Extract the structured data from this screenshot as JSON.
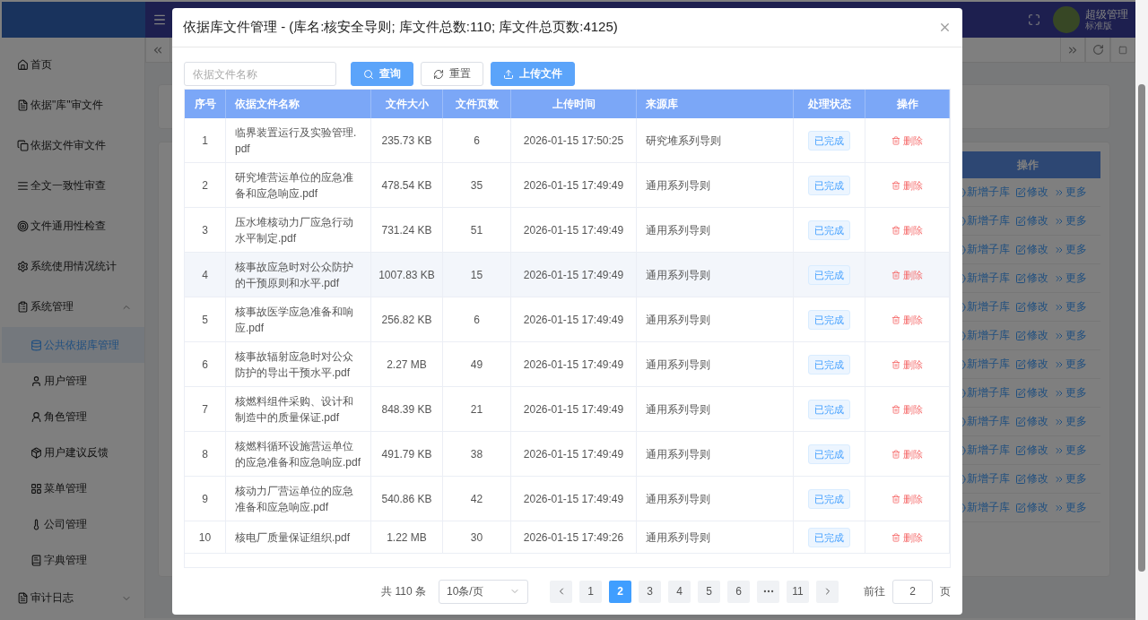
{
  "header": {
    "user_name": "超级管理",
    "edition": "标准版"
  },
  "sidebar": {
    "items": [
      {
        "label": "首页",
        "selected": false
      },
      {
        "label": "依据\"库\"审文件",
        "selected": false
      },
      {
        "label": "依据文件审文件",
        "selected": false
      },
      {
        "label": "全文一致性审查",
        "selected": false
      },
      {
        "label": "文件通用性检查",
        "selected": false
      },
      {
        "label": "系统使用情况统计",
        "selected": false
      },
      {
        "label": "系统管理",
        "selected": false,
        "expanded": true,
        "children": [
          {
            "label": "公共依据库管理",
            "selected": true
          },
          {
            "label": "用户管理",
            "selected": false
          },
          {
            "label": "角色管理",
            "selected": false
          },
          {
            "label": "用户建议反馈",
            "selected": false
          },
          {
            "label": "菜单管理",
            "selected": false
          },
          {
            "label": "公司管理",
            "selected": false
          },
          {
            "label": "字典管理",
            "selected": false
          }
        ]
      },
      {
        "label": "审计日志",
        "selected": false,
        "expanded": false
      }
    ]
  },
  "background_table": {
    "column_header": "操作",
    "rows": [
      {
        "actions": [
          "新增子库",
          "修改",
          "更多"
        ]
      },
      {
        "actions": [
          "新增子库",
          "修改",
          "更多"
        ]
      },
      {
        "actions": [
          "新增子库",
          "修改",
          "更多"
        ]
      },
      {
        "actions": [
          "新增子库",
          "修改",
          "更多"
        ]
      },
      {
        "actions": [
          "新增子库",
          "修改",
          "更多"
        ]
      },
      {
        "actions": [
          "新增子库",
          "修改",
          "更多"
        ]
      },
      {
        "actions": [
          "新增子库",
          "修改",
          "更多"
        ]
      },
      {
        "actions": [
          "新增子库",
          "修改",
          "更多"
        ]
      },
      {
        "actions": [
          "新增子库",
          "修改",
          "更多"
        ]
      },
      {
        "actions": [
          "新增子库",
          "修改",
          "更多"
        ]
      },
      {
        "actions": [
          "新增子库",
          "修改",
          "更多"
        ]
      },
      {
        "actions": [
          "新增子库",
          "修改",
          "更多"
        ]
      }
    ]
  },
  "dialog": {
    "title": "依据库文件管理 - (库名:核安全导则; 库文件总数:110; 库文件总页数:4125)",
    "search": {
      "placeholder": "依据文件名称"
    },
    "buttons": [
      {
        "label": "查询",
        "kind": "search"
      },
      {
        "label": "重置",
        "kind": "reset"
      },
      {
        "label": "上传文件",
        "kind": "upload"
      }
    ],
    "table": {
      "columns": [
        "序号",
        "依据文件名称",
        "文件大小",
        "文件页数",
        "上传时间",
        "来源库",
        "处理状态",
        "操作"
      ],
      "rows": [
        {
          "index": "1",
          "name": "临界装置运行及实验管理.pdf",
          "size": "235.73 KB",
          "pages": "6",
          "time": "2026-01-15 17:50:25",
          "source": "研究堆系列导则",
          "status": "已完成",
          "action": "删除",
          "selected": false
        },
        {
          "index": "2",
          "name": "研究堆营运单位的应急准备和应急响应.pdf",
          "size": "478.54 KB",
          "pages": "35",
          "time": "2026-01-15 17:49:49",
          "source": "通用系列导则",
          "status": "已完成",
          "action": "删除",
          "selected": false
        },
        {
          "index": "3",
          "name": "压水堆核动力厂应急行动水平制定.pdf",
          "size": "731.24 KB",
          "pages": "51",
          "time": "2026-01-15 17:49:49",
          "source": "通用系列导则",
          "status": "已完成",
          "action": "删除",
          "selected": false
        },
        {
          "index": "4",
          "name": "核事故应急时对公众防护的干预原则和水平.pdf",
          "size": "1007.83 KB",
          "pages": "15",
          "time": "2026-01-15 17:49:49",
          "source": "通用系列导则",
          "status": "已完成",
          "action": "删除",
          "selected": true
        },
        {
          "index": "5",
          "name": "核事故医学应急准备和响应.pdf",
          "size": "256.82 KB",
          "pages": "6",
          "time": "2026-01-15 17:49:49",
          "source": "通用系列导则",
          "status": "已完成",
          "action": "删除",
          "selected": false
        },
        {
          "index": "6",
          "name": "核事故辐射应急时对公众防护的导出干预水平.pdf",
          "size": "2.27 MB",
          "pages": "49",
          "time": "2026-01-15 17:49:49",
          "source": "通用系列导则",
          "status": "已完成",
          "action": "删除",
          "selected": false
        },
        {
          "index": "7",
          "name": "核燃料组件采购、设计和制造中的质量保证.pdf",
          "size": "848.39 KB",
          "pages": "21",
          "time": "2026-01-15 17:49:49",
          "source": "通用系列导则",
          "status": "已完成",
          "action": "删除",
          "selected": false
        },
        {
          "index": "8",
          "name": "核燃料循环设施营运单位的应急准备和应急响应.pdf",
          "size": "491.79 KB",
          "pages": "38",
          "time": "2026-01-15 17:49:49",
          "source": "通用系列导则",
          "status": "已完成",
          "action": "删除",
          "selected": false
        },
        {
          "index": "9",
          "name": "核动力厂营运单位的应急准备和应急响应.pdf",
          "size": "540.86 KB",
          "pages": "42",
          "time": "2026-01-15 17:49:49",
          "source": "通用系列导则",
          "status": "已完成",
          "action": "删除",
          "selected": false
        },
        {
          "index": "10",
          "name": "核电厂质量保证组织.pdf",
          "size": "1.22 MB",
          "pages": "30",
          "time": "2026-01-15 17:49:26",
          "source": "通用系列导则",
          "status": "已完成",
          "action": "删除",
          "selected": false
        }
      ]
    },
    "pagination": {
      "total": "共 110 条",
      "page_size": "10条/页",
      "pages": [
        {
          "kind": "page",
          "label": "1",
          "selected": false
        },
        {
          "kind": "page",
          "label": "2",
          "selected": true
        },
        {
          "kind": "page",
          "label": "3",
          "selected": false
        },
        {
          "kind": "page",
          "label": "4",
          "selected": false
        },
        {
          "kind": "page",
          "label": "5",
          "selected": false
        },
        {
          "kind": "page",
          "label": "6",
          "selected": false
        },
        {
          "kind": "more",
          "selected": false
        },
        {
          "kind": "page",
          "label": "11",
          "selected": false
        }
      ],
      "goto_label": "前往",
      "goto_value": "2",
      "page_unit": "页"
    }
  }
}
